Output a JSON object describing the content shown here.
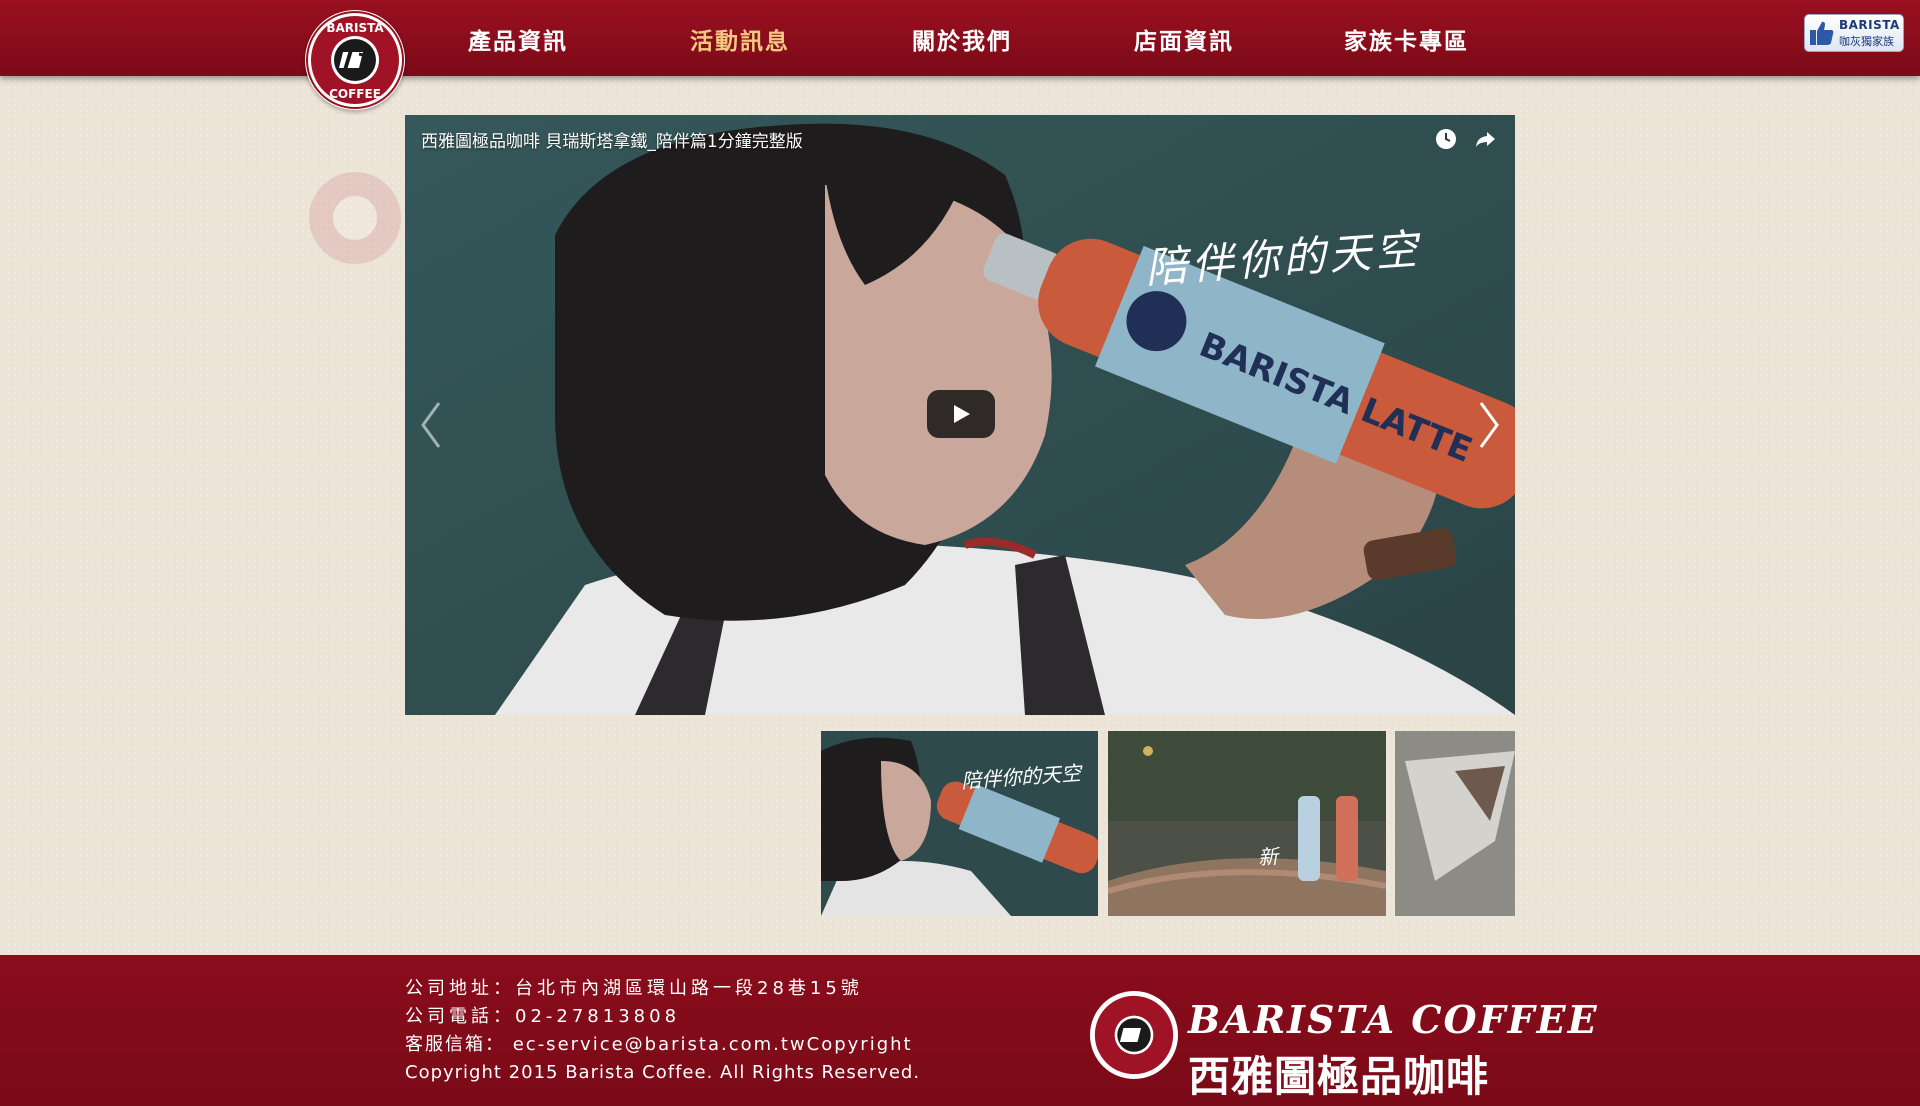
{
  "header": {
    "logo_text": "BARISTA COFFEE",
    "nav": [
      {
        "label": "產品資訊",
        "active": false
      },
      {
        "label": "活動訊息",
        "active": true
      },
      {
        "label": "關於我們",
        "active": false
      },
      {
        "label": "店面資訊",
        "active": false
      },
      {
        "label": "家族卡專區",
        "active": false
      }
    ],
    "fb_badge": {
      "line1": "BARISTA",
      "line2": "咖灰獨家族",
      "icon": "thumbs-up-icon"
    }
  },
  "video": {
    "title": "西雅圖極品咖啡 貝瑞斯塔拿鐵_陪伴篇1分鐘完整版",
    "caption": "陪伴你的天空",
    "bottle_label": "BARISTA LATTE",
    "icons": [
      "watch-later-icon",
      "share-icon",
      "play-icon",
      "prev-arrow-icon",
      "next-arrow-icon"
    ]
  },
  "thumbnails": [
    {
      "caption": "陪伴你的天空"
    },
    {
      "caption": "新"
    },
    {
      "caption": ""
    }
  ],
  "footer": {
    "address": "公司地址：台北市內湖區環山路一段28巷15號",
    "phone": "公司電話：02-27813808",
    "email": "客服信箱： ec-service@barista.com.twCopyright",
    "copyright": "Copyright 2015 Barista Coffee. All Rights Reserved.",
    "brand_en": "BARISTA COFFEE",
    "brand_zh": "西雅圖極品咖啡"
  },
  "colors": {
    "header_red": "#8b0e1d",
    "active_nav": "#f3c981",
    "footer_red": "#820b1a",
    "page_bg": "#ede4d8"
  }
}
